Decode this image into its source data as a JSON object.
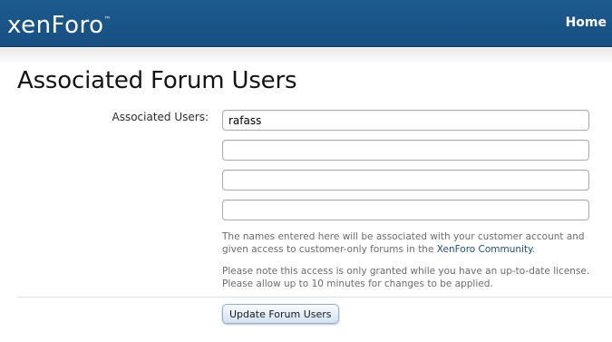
{
  "header": {
    "logo_text": "xenForo",
    "logo_trademark": "™",
    "home_link": "Home"
  },
  "page": {
    "title": "Associated Forum Users"
  },
  "form": {
    "label": "Associated Users:",
    "inputs": [
      {
        "value": "rafass"
      },
      {
        "value": ""
      },
      {
        "value": ""
      },
      {
        "value": ""
      }
    ],
    "explain1_before": "The names entered here will be associated with your customer account and given access to customer-only forums in the ",
    "explain1_link": "XenForo Community",
    "explain1_after": ".",
    "explain2_line1": "Please note this access is only granted while you have an up-to-date license.",
    "explain2_line2": "Please allow up to 10 minutes for changes to be applied.",
    "submit_label": "Update Forum Users"
  },
  "colors": {
    "header_bg": "#1d5a8e",
    "link": "#1d4f80"
  }
}
